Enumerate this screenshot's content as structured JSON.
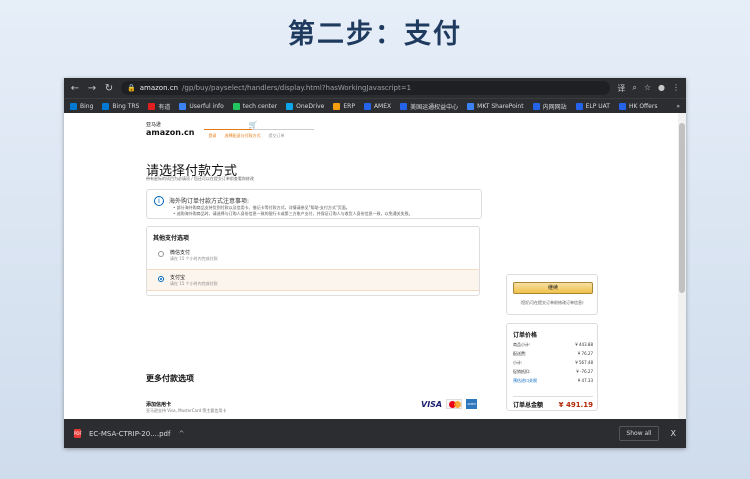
{
  "slide": {
    "title": "第二步：支付"
  },
  "browser": {
    "url_domain": "amazon.cn",
    "url_path": "/gp/buy/payselect/handlers/display.html?hasWorkingJavascript=1",
    "bookmarks": [
      {
        "label": "Bing",
        "color": "#0078d4"
      },
      {
        "label": "Bing TRS",
        "color": "#0078d4"
      },
      {
        "label": "有道",
        "color": "#e02020"
      },
      {
        "label": "Userful info",
        "color": "#3b82f6"
      },
      {
        "label": "tech center",
        "color": "#22c55e"
      },
      {
        "label": "OneDrive",
        "color": "#0ea5e9"
      },
      {
        "label": "ERP",
        "color": "#f59e0b"
      },
      {
        "label": "AMEX",
        "color": "#2563eb"
      },
      {
        "label": "美国运通权益中心",
        "color": "#2563eb"
      },
      {
        "label": "MKT SharePoint",
        "color": "#3b82f6"
      },
      {
        "label": "内网网站",
        "color": "#2563eb"
      },
      {
        "label": "ELP UAT",
        "color": "#2563eb"
      },
      {
        "label": "HK Offers",
        "color": "#2563eb"
      }
    ],
    "bookmarks_more": "»"
  },
  "page": {
    "logo_cn": "亚马逊",
    "logo_en": "amazon.cn",
    "steps": [
      "登录",
      "选择配送与付款方式",
      "提交订单"
    ],
    "title": "请选择付款方式",
    "subtitle": "带有星标的项目为必填项 / 您还可以在提交订单前查看和修改",
    "notice_title": "海外购订单付款方式注意事项:",
    "notice_lines": [
      "• 部分海外购商品支持货到付款以及信用卡、借记卡等付款方式，详情请参见\"帮助-支付方式\"页面。",
      "• 选购海外购商品时，请选择与订购人身份信息一致的银行卡或第三方账户支付，并保证订购人与收货人身份信息一致，以免通关失败。"
    ],
    "methods_header": "其他支付选项",
    "methods": [
      {
        "name": "微信支付",
        "desc": "请在 15 个小时内完成付款",
        "selected": false
      },
      {
        "name": "支付宝",
        "desc": "请在 15 个小时内完成付款",
        "selected": true
      }
    ],
    "more_title": "更多付款选项",
    "card_title": "添加信用卡",
    "card_sub": "亚马逊支持 Visa, MasterCard 等主要信用卡",
    "visa": "VISA",
    "amex": "AMEX"
  },
  "sidebar": {
    "continue_label": "继续",
    "continue_note": "(您仍可在提交订单前修改订单信息)",
    "summary_title": "订单价格",
    "rows": [
      {
        "label": "商品小计:",
        "value": "¥ 443.88"
      },
      {
        "label": "配送费:",
        "value": "¥ 76.27"
      },
      {
        "label": "小计:",
        "value": "¥ 567.48"
      },
      {
        "label": "促销抵扣:",
        "value": "¥ -76.27"
      },
      {
        "label": "预估进口关税",
        "value": "¥ 47.33"
      }
    ],
    "total_label": "订单总金额",
    "total_value": "¥ 491.19"
  },
  "download": {
    "filename": "EC-MSA-CTRIP-20....pdf",
    "pdf_badge": "PDF",
    "show_all": "Show all",
    "close": "X"
  }
}
